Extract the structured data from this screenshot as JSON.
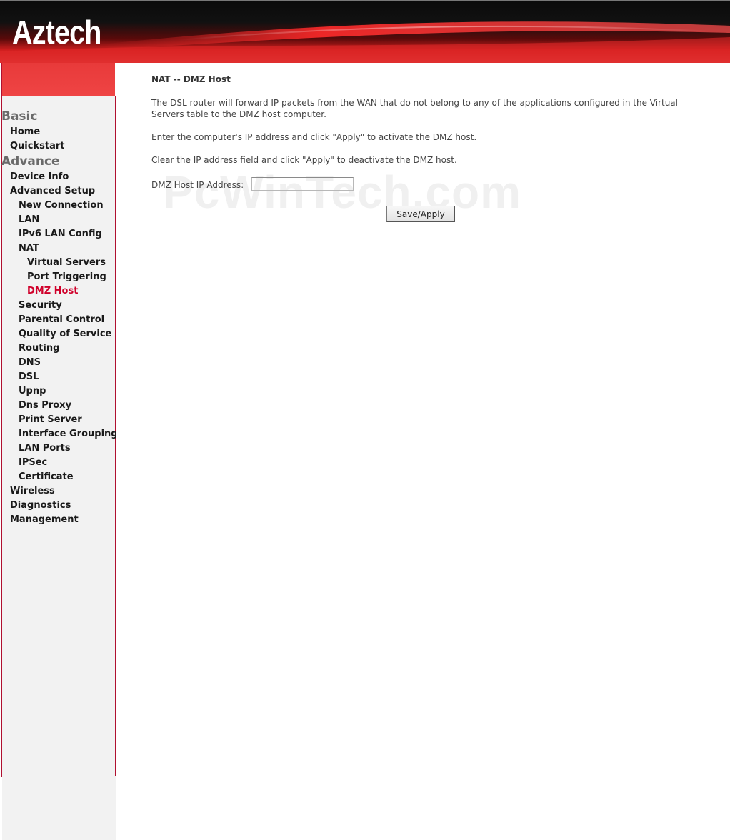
{
  "brand": {
    "logo_text": "Aztech"
  },
  "sidebar": {
    "sections": [
      {
        "label": "Basic"
      },
      {
        "label": "Advance"
      }
    ],
    "items": [
      {
        "label": "Home"
      },
      {
        "label": "Quickstart"
      },
      {
        "label": "Device Info"
      },
      {
        "label": "Advanced Setup"
      },
      {
        "label": "New Connection"
      },
      {
        "label": "LAN"
      },
      {
        "label": "IPv6 LAN Config"
      },
      {
        "label": "NAT"
      },
      {
        "label": "Virtual Servers"
      },
      {
        "label": "Port Triggering"
      },
      {
        "label": "DMZ Host",
        "active": true
      },
      {
        "label": "Security"
      },
      {
        "label": "Parental Control"
      },
      {
        "label": "Quality of Service"
      },
      {
        "label": "Routing"
      },
      {
        "label": "DNS"
      },
      {
        "label": "DSL"
      },
      {
        "label": "Upnp"
      },
      {
        "label": "Dns Proxy"
      },
      {
        "label": "Print Server"
      },
      {
        "label": "Interface Grouping"
      },
      {
        "label": "LAN Ports"
      },
      {
        "label": "IPSec"
      },
      {
        "label": "Certificate"
      },
      {
        "label": "Wireless"
      },
      {
        "label": "Diagnostics"
      },
      {
        "label": "Management"
      }
    ]
  },
  "main": {
    "title": "NAT -- DMZ Host",
    "paragraphs": [
      "The DSL router will forward IP packets from the WAN that do not belong to any of the applications configured in the Virtual Servers table to the DMZ host computer.",
      "Enter the computer's IP address and click \"Apply\" to activate the DMZ host.",
      "Clear the IP address field and click \"Apply\" to deactivate the DMZ host."
    ],
    "ip_field": {
      "label": "DMZ Host IP Address:",
      "value": ""
    },
    "save_button": "Save/Apply"
  },
  "watermark": "PcWinTech.com",
  "colors": {
    "accent_red": "#e23a3a",
    "active_nav": "#d0002a",
    "sidebar_bg": "#f2f2f2",
    "sidebar_border": "#b01030"
  }
}
